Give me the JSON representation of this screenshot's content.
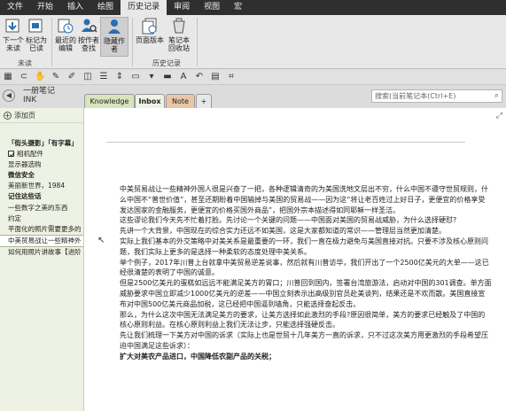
{
  "menu_tabs": [
    "文件",
    "开始",
    "插入",
    "绘图",
    "历史记录",
    "审阅",
    "视图",
    "宏"
  ],
  "active_menu_tab": "历史记录",
  "ribbon": {
    "next_unread": "下一个\n未读",
    "mark_read": "标记为\n已读",
    "group_unread": "未读",
    "recent_edits": "最近的\n编辑",
    "find_by_author": "按作者\n查找",
    "hide_authors": "隐藏作者",
    "page_versions": "页面版本",
    "notebook_recycle": "笔记本\n回收站",
    "group_history": "历史记录"
  },
  "notebook": {
    "name_line1": "一册笔记",
    "name_line2": "INK",
    "sections": [
      "Knowledge",
      "Inbox",
      "Note",
      "+"
    ],
    "active_section": "Inbox",
    "search_placeholder": "搜索(当前笔记本(Ctrl+E)"
  },
  "page_list": {
    "add_page": "添加页",
    "items": [
      {
        "text": "「街头摄影」「有字幕」",
        "bold": true,
        "check": false,
        "sel": false
      },
      {
        "text": "相机配件",
        "bold": false,
        "check": true,
        "sel": false
      },
      {
        "text": "显示器选购",
        "bold": false,
        "check": false,
        "sel": false
      },
      {
        "text": "微信安全",
        "bold": true,
        "check": false,
        "sel": false
      },
      {
        "text": "美丽新世界，1984",
        "bold": false,
        "check": false,
        "sel": false
      },
      {
        "text": "记住这些话",
        "bold": true,
        "check": false,
        "sel": false
      },
      {
        "text": "一些数字之美的东西",
        "bold": false,
        "check": false,
        "sel": false
      },
      {
        "text": "约定",
        "bold": false,
        "check": false,
        "sel": false
      },
      {
        "text": "平面化的照片需要更多的",
        "bold": false,
        "check": false,
        "sel": false
      },
      {
        "text": "中美贸易战让一些精神外",
        "bold": false,
        "check": false,
        "sel": true
      },
      {
        "text": "如何用照片讲故事【进阶",
        "bold": false,
        "check": false,
        "sel": false
      }
    ]
  },
  "page_body": [
    {
      "text": "中美贸易战让一些精神外国人很是兴奋了一把，各种逻辑清奇的为美国洗地文层出不穷，什么中国不遵守世贸规则，什么中国不“普世价值”，甚至还期盼着中国输掉与美国的贸易战——因为这“将让老百姓过上好日子，更便宜的价格享受发达国家的金融服务，更便宜的价格买国外商品”，把国外宗本描述得如同耶稣一样圣洁。",
      "bold": false
    },
    {
      "text": "这些谬论我们今天先不忙着打脸。先讨论一个关键的问题——中国面对美国的贸易战威胁，为什么选择硬怼?",
      "bold": false
    },
    {
      "text": "先讲一个大背景，中国现在的综合实力还远不如美国，这是大家都知道的常识——管理层当然更加清楚。",
      "bold": false
    },
    {
      "text": "实际上我们基本的外交策略中对美关系是最重要的一环，我们一直在极力避免与美国直接对抗。只要不涉及核心原则问题，我们实际上更多的是选择一种柔软的态度处理中美关系。",
      "bold": false
    },
    {
      "text": "举个例子，2017年川普上台就拿中美贸易逆差说事，然后就有川普访华，我们开出了一个2500亿美元的大单——这已经很清楚的表明了中国的诚意。",
      "bold": false
    },
    {
      "text": "但是2500亿美元的蛋糕如远远不能满足美方的胃口；川普回到国内，签署台湾旅游法，启动对中国的301调查。单方面威胁要求中国立即减少1000亿美元的逆差——中国立刻表示出高级别官员赴美谈判，结果还是不欢而散。美国直接宣布对中国500亿美元商品加税，这已经把中国逼到墙角，只能选择奋起反击。",
      "bold": false
    },
    {
      "text": "那么，为什么这次中国无法满足美方的要求，让美方选择如此激烈的手段?原因很简单，美方的要求已经触及了中国的核心原则利益。在核心原则利益上我们无法让步，只能选择强硬反击。",
      "bold": false
    },
    {
      "text": "先让我们梳理一下美方对中国的诉求（实际上也是世贸十几年美方一直的诉求，只不过这次美方用更激烈的手段希望压迫中国满足这些诉求）：",
      "bold": false
    },
    {
      "text": "扩大对美农产品进口，中国降低农副产品的关税；",
      "bold": true
    }
  ]
}
